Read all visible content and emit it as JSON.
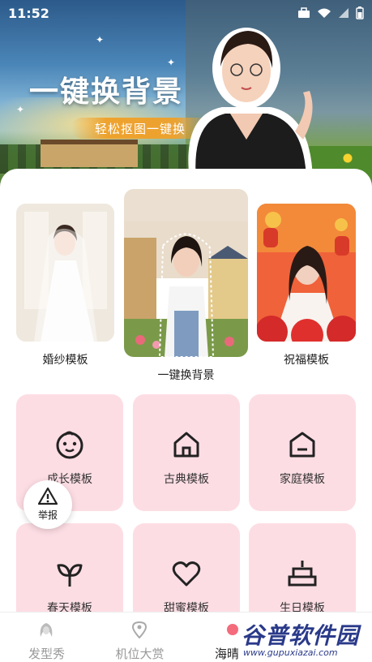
{
  "status_bar": {
    "time": "11:52"
  },
  "hero": {
    "title": "一键换背景",
    "subtitle": "轻松抠图一键换"
  },
  "featured_templates": [
    {
      "label": "婚纱模板"
    },
    {
      "label": "一键换背景"
    },
    {
      "label": "祝福模板"
    }
  ],
  "grid_templates": [
    {
      "label": "成长模板",
      "icon": "baby-face-icon"
    },
    {
      "label": "古典模板",
      "icon": "classical-house-icon"
    },
    {
      "label": "家庭模板",
      "icon": "home-icon"
    },
    {
      "label": "春天模板",
      "icon": "leaf-icon"
    },
    {
      "label": "甜蜜模板",
      "icon": "heart-icon"
    },
    {
      "label": "生日模板",
      "icon": "birthday-cake-icon"
    }
  ],
  "report_button": {
    "label": "举报",
    "icon": "warning-triangle-icon"
  },
  "bottom_nav": [
    {
      "label": "发型秀",
      "icon": "woman-hair-icon",
      "active": false
    },
    {
      "label": "机位大赏",
      "icon": "location-pin-icon",
      "active": false
    },
    {
      "label": "海晴模",
      "icon": "dot-icon",
      "active": true
    }
  ],
  "watermark": {
    "main": "谷普软件园",
    "url": "www.gupuxiazai.com"
  },
  "colors": {
    "tile_bg": "#fddde4",
    "hero_pill": "#f0a028",
    "watermark": "#2a3a8a"
  }
}
